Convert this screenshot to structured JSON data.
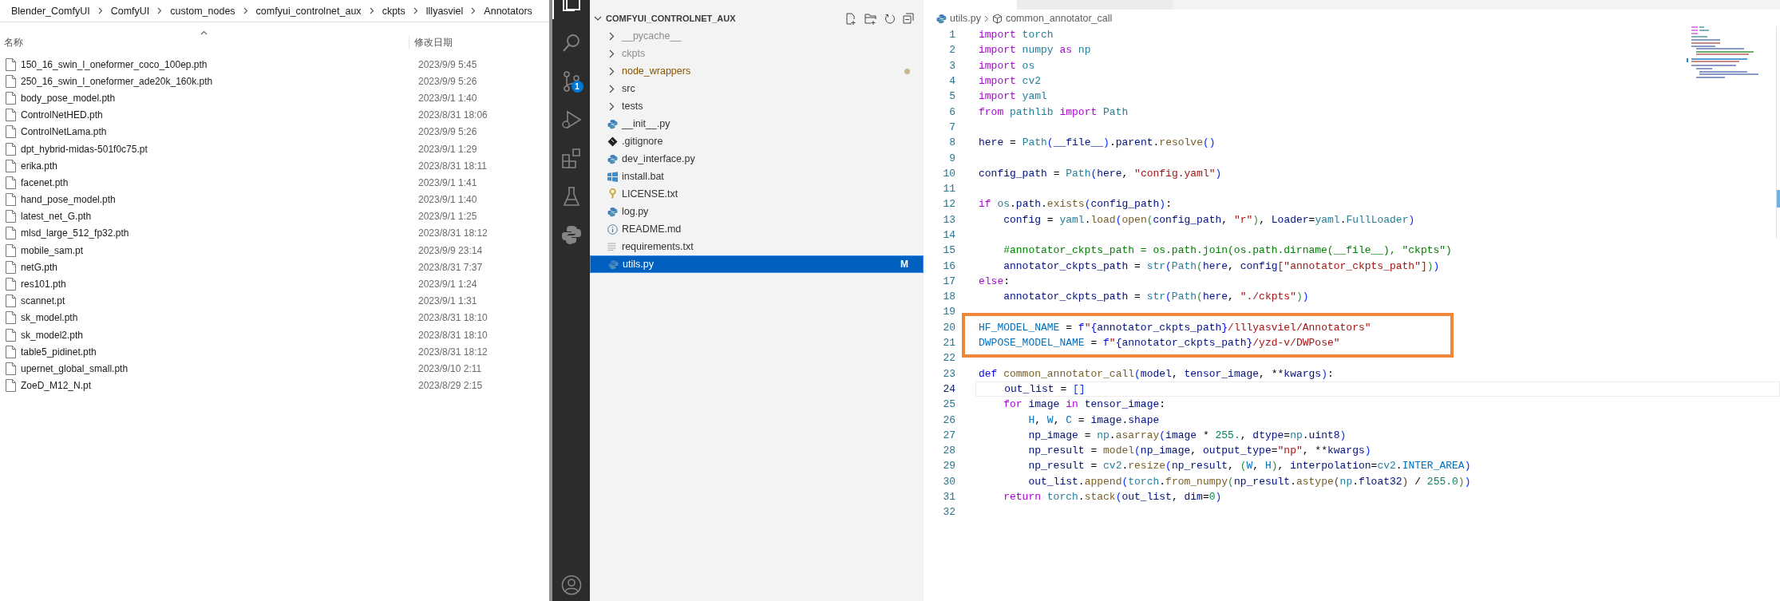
{
  "file_explorer": {
    "breadcrumb": [
      "Blender_ComfyUI",
      "ComfyUI",
      "custom_nodes",
      "comfyui_controlnet_aux",
      "ckpts",
      "lllyasviel",
      "Annotators"
    ],
    "columns": [
      "名称",
      "修改日期"
    ],
    "files": [
      {
        "name": "150_16_swin_l_oneformer_coco_100ep.pth",
        "date": "2023/9/9 5:45"
      },
      {
        "name": "250_16_swin_l_oneformer_ade20k_160k.pth",
        "date": "2023/9/9 5:26"
      },
      {
        "name": "body_pose_model.pth",
        "date": "2023/9/1 1:40"
      },
      {
        "name": "ControlNetHED.pth",
        "date": "2023/8/31 18:06"
      },
      {
        "name": "ControlNetLama.pth",
        "date": "2023/9/9 5:26"
      },
      {
        "name": "dpt_hybrid-midas-501f0c75.pt",
        "date": "2023/9/1 1:29"
      },
      {
        "name": "erika.pth",
        "date": "2023/8/31 18:11"
      },
      {
        "name": "facenet.pth",
        "date": "2023/9/1 1:41"
      },
      {
        "name": "hand_pose_model.pth",
        "date": "2023/9/1 1:40"
      },
      {
        "name": "latest_net_G.pth",
        "date": "2023/9/1 1:25"
      },
      {
        "name": "mlsd_large_512_fp32.pth",
        "date": "2023/8/31 18:12"
      },
      {
        "name": "mobile_sam.pt",
        "date": "2023/9/9 23:14"
      },
      {
        "name": "netG.pth",
        "date": "2023/8/31 7:37"
      },
      {
        "name": "res101.pth",
        "date": "2023/9/1 1:24"
      },
      {
        "name": "scannet.pt",
        "date": "2023/9/1 1:31"
      },
      {
        "name": "sk_model.pth",
        "date": "2023/8/31 18:10"
      },
      {
        "name": "sk_model2.pth",
        "date": "2023/8/31 18:10"
      },
      {
        "name": "table5_pidinet.pth",
        "date": "2023/8/31 18:12"
      },
      {
        "name": "upernet_global_small.pth",
        "date": "2023/9/10 2:11"
      },
      {
        "name": "ZoeD_M12_N.pt",
        "date": "2023/8/29 2:15"
      }
    ]
  },
  "activity_bar": {
    "source_control_badge": "1"
  },
  "sidebar": {
    "title": "COMFYUI_CONTROLNET_AUX",
    "items": [
      {
        "kind": "folder",
        "label": "__pycache__",
        "ignored": true,
        "has_changes": false,
        "selected": false
      },
      {
        "kind": "folder",
        "label": "ckpts",
        "ignored": true,
        "has_changes": false,
        "selected": false
      },
      {
        "kind": "folder",
        "label": "node_wrappers",
        "ignored": false,
        "has_changes": true,
        "selected": false
      },
      {
        "kind": "folder",
        "label": "src",
        "ignored": false,
        "has_changes": false,
        "selected": false
      },
      {
        "kind": "folder",
        "label": "tests",
        "ignored": false,
        "has_changes": false,
        "selected": false
      },
      {
        "kind": "python",
        "label": "__init__.py",
        "ignored": false,
        "has_changes": false,
        "selected": false
      },
      {
        "kind": "git",
        "label": ".gitignore",
        "ignored": false,
        "has_changes": false,
        "selected": false
      },
      {
        "kind": "python",
        "label": "dev_interface.py",
        "ignored": false,
        "has_changes": false,
        "selected": false
      },
      {
        "kind": "windows",
        "label": "install.bat",
        "ignored": false,
        "has_changes": false,
        "selected": false
      },
      {
        "kind": "license",
        "label": "LICENSE.txt",
        "ignored": false,
        "has_changes": false,
        "selected": false
      },
      {
        "kind": "python",
        "label": "log.py",
        "ignored": false,
        "has_changes": false,
        "selected": false
      },
      {
        "kind": "info",
        "label": "README.md",
        "ignored": false,
        "has_changes": false,
        "selected": false
      },
      {
        "kind": "text",
        "label": "requirements.txt",
        "ignored": false,
        "has_changes": false,
        "selected": false
      },
      {
        "kind": "python",
        "label": "utils.py",
        "ignored": false,
        "has_changes": false,
        "selected": true,
        "status": "M"
      }
    ]
  },
  "editor": {
    "breadcrumb": {
      "file": "utils.py",
      "symbol": "common_annotator_call"
    },
    "lines": [
      {
        "number": "1",
        "current": false,
        "boxed": false,
        "tokens": [
          {
            "kind": "keyword",
            "text": "import"
          },
          {
            "kind": "module",
            "text": " torch"
          }
        ]
      },
      {
        "number": "2",
        "current": false,
        "boxed": false,
        "tokens": [
          {
            "kind": "keyword",
            "text": "import"
          },
          {
            "kind": "module",
            "text": " numpy "
          },
          {
            "kind": "keyword",
            "text": "as"
          },
          {
            "kind": "module",
            "text": " np"
          }
        ]
      },
      {
        "number": "3",
        "current": false,
        "boxed": false,
        "tokens": [
          {
            "kind": "keyword",
            "text": "import"
          },
          {
            "kind": "module",
            "text": " os"
          }
        ]
      },
      {
        "number": "4",
        "current": false,
        "boxed": false,
        "tokens": [
          {
            "kind": "keyword",
            "text": "import"
          },
          {
            "kind": "module",
            "text": " cv2"
          }
        ]
      },
      {
        "number": "5",
        "current": false,
        "boxed": false,
        "tokens": [
          {
            "kind": "keyword",
            "text": "import"
          },
          {
            "kind": "module",
            "text": " yaml"
          }
        ]
      },
      {
        "number": "6",
        "current": false,
        "boxed": false,
        "tokens": [
          {
            "kind": "keyword",
            "text": "from"
          },
          {
            "kind": "module",
            "text": " pathlib "
          },
          {
            "kind": "keyword",
            "text": "import"
          },
          {
            "kind": "module",
            "text": " Path"
          }
        ]
      },
      {
        "number": "7",
        "current": false,
        "boxed": false
      },
      {
        "number": "8",
        "current": false,
        "boxed": false,
        "tokens": [
          {
            "kind": "variable",
            "text": "here"
          },
          {
            "kind": "plain",
            "text": " = "
          },
          {
            "kind": "module",
            "text": "Path"
          },
          {
            "kind": "bracket1",
            "text": "("
          },
          {
            "kind": "variable",
            "text": "__file__"
          },
          {
            "kind": "bracket1",
            "text": ")"
          },
          {
            "kind": "plain",
            "text": "."
          },
          {
            "kind": "variable",
            "text": "parent"
          },
          {
            "kind": "plain",
            "text": "."
          },
          {
            "kind": "function",
            "text": "resolve"
          },
          {
            "kind": "bracket1",
            "text": "()"
          }
        ]
      },
      {
        "number": "9",
        "current": false,
        "boxed": false
      },
      {
        "number": "10",
        "current": false,
        "boxed": false,
        "tokens": [
          {
            "kind": "variable",
            "text": "config_path"
          },
          {
            "kind": "plain",
            "text": " = "
          },
          {
            "kind": "module",
            "text": "Path"
          },
          {
            "kind": "bracket1",
            "text": "("
          },
          {
            "kind": "variable",
            "text": "here"
          },
          {
            "kind": "plain",
            "text": ", "
          },
          {
            "kind": "string",
            "text": "\"config.yaml\""
          },
          {
            "kind": "bracket1",
            "text": ")"
          }
        ]
      },
      {
        "number": "11",
        "current": false,
        "boxed": false
      },
      {
        "number": "12",
        "current": false,
        "boxed": false,
        "tokens": [
          {
            "kind": "keyword",
            "text": "if"
          },
          {
            "kind": "module",
            "text": " os"
          },
          {
            "kind": "plain",
            "text": "."
          },
          {
            "kind": "variable",
            "text": "path"
          },
          {
            "kind": "plain",
            "text": "."
          },
          {
            "kind": "function",
            "text": "exists"
          },
          {
            "kind": "bracket1",
            "text": "("
          },
          {
            "kind": "variable",
            "text": "config_path"
          },
          {
            "kind": "bracket1",
            "text": ")"
          },
          {
            "kind": "plain",
            "text": ":"
          }
        ]
      },
      {
        "number": "13",
        "current": false,
        "boxed": false,
        "tokens": [
          {
            "kind": "variable",
            "text": "    config"
          },
          {
            "kind": "plain",
            "text": " = "
          },
          {
            "kind": "module",
            "text": "yaml"
          },
          {
            "kind": "plain",
            "text": "."
          },
          {
            "kind": "function",
            "text": "load"
          },
          {
            "kind": "bracket1",
            "text": "("
          },
          {
            "kind": "function",
            "text": "open"
          },
          {
            "kind": "bracket2",
            "text": "("
          },
          {
            "kind": "variable",
            "text": "config_path"
          },
          {
            "kind": "plain",
            "text": ", "
          },
          {
            "kind": "string",
            "text": "\"r\""
          },
          {
            "kind": "bracket2",
            "text": ")"
          },
          {
            "kind": "plain",
            "text": ", "
          },
          {
            "kind": "variable",
            "text": "Loader"
          },
          {
            "kind": "plain",
            "text": "="
          },
          {
            "kind": "module",
            "text": "yaml"
          },
          {
            "kind": "plain",
            "text": "."
          },
          {
            "kind": "module",
            "text": "FullLoader"
          },
          {
            "kind": "bracket1",
            "text": ")"
          }
        ]
      },
      {
        "number": "14",
        "current": false,
        "boxed": false
      },
      {
        "number": "15",
        "current": false,
        "boxed": false,
        "tokens": [
          {
            "kind": "comment",
            "text": "    #annotator_ckpts_path = os.path.join(os.path.dirname(__file__), \"ckpts\")"
          }
        ]
      },
      {
        "number": "16",
        "current": false,
        "boxed": false,
        "tokens": [
          {
            "kind": "variable",
            "text": "    annotator_ckpts_path"
          },
          {
            "kind": "plain",
            "text": " = "
          },
          {
            "kind": "module",
            "text": "str"
          },
          {
            "kind": "bracket1",
            "text": "("
          },
          {
            "kind": "module",
            "text": "Path"
          },
          {
            "kind": "bracket2",
            "text": "("
          },
          {
            "kind": "variable",
            "text": "here"
          },
          {
            "kind": "plain",
            "text": ", "
          },
          {
            "kind": "variable",
            "text": "config"
          },
          {
            "kind": "bracket3",
            "text": "["
          },
          {
            "kind": "string",
            "text": "\"annotator_ckpts_path\""
          },
          {
            "kind": "bracket3",
            "text": "]"
          },
          {
            "kind": "bracket2",
            "text": ")"
          },
          {
            "kind": "bracket1",
            "text": ")"
          }
        ]
      },
      {
        "number": "17",
        "current": false,
        "boxed": false,
        "tokens": [
          {
            "kind": "keyword",
            "text": "else"
          },
          {
            "kind": "plain",
            "text": ":"
          }
        ]
      },
      {
        "number": "18",
        "current": false,
        "boxed": false,
        "tokens": [
          {
            "kind": "variable",
            "text": "    annotator_ckpts_path"
          },
          {
            "kind": "plain",
            "text": " = "
          },
          {
            "kind": "module",
            "text": "str"
          },
          {
            "kind": "bracket1",
            "text": "("
          },
          {
            "kind": "module",
            "text": "Path"
          },
          {
            "kind": "bracket2",
            "text": "("
          },
          {
            "kind": "variable",
            "text": "here"
          },
          {
            "kind": "plain",
            "text": ", "
          },
          {
            "kind": "string",
            "text": "\"./ckpts\""
          },
          {
            "kind": "bracket2",
            "text": ")"
          },
          {
            "kind": "bracket1",
            "text": ")"
          }
        ]
      },
      {
        "number": "19",
        "current": false,
        "boxed": false
      },
      {
        "number": "20",
        "current": false,
        "boxed": true,
        "tokens": [
          {
            "kind": "constant",
            "text": "HF_MODEL_NAME"
          },
          {
            "kind": "plain",
            "text": " = "
          },
          {
            "kind": "storage",
            "text": "f"
          },
          {
            "kind": "string",
            "text": "\""
          },
          {
            "kind": "storage",
            "text": "{"
          },
          {
            "kind": "variable",
            "text": "annotator_ckpts_path"
          },
          {
            "kind": "storage",
            "text": "}"
          },
          {
            "kind": "string",
            "text": "/lllyasviel/Annotators\""
          }
        ]
      },
      {
        "number": "21",
        "current": false,
        "boxed": true,
        "tokens": [
          {
            "kind": "constant",
            "text": "DWPOSE_MODEL_NAME"
          },
          {
            "kind": "plain",
            "text": " = "
          },
          {
            "kind": "storage",
            "text": "f"
          },
          {
            "kind": "string",
            "text": "\""
          },
          {
            "kind": "storage",
            "text": "{"
          },
          {
            "kind": "variable",
            "text": "annotator_ckpts_path"
          },
          {
            "kind": "storage",
            "text": "}"
          },
          {
            "kind": "string",
            "text": "/yzd-v/DWPose\""
          }
        ]
      },
      {
        "number": "22",
        "current": false,
        "boxed": false
      },
      {
        "number": "23",
        "current": false,
        "boxed": false,
        "tokens": [
          {
            "kind": "storage",
            "text": "def"
          },
          {
            "kind": "function",
            "text": " common_annotator_call"
          },
          {
            "kind": "bracket1",
            "text": "("
          },
          {
            "kind": "variable",
            "text": "model"
          },
          {
            "kind": "plain",
            "text": ", "
          },
          {
            "kind": "variable",
            "text": "tensor_image"
          },
          {
            "kind": "plain",
            "text": ", **"
          },
          {
            "kind": "variable",
            "text": "kwargs"
          },
          {
            "kind": "bracket1",
            "text": ")"
          },
          {
            "kind": "plain",
            "text": ":"
          }
        ]
      },
      {
        "number": "24",
        "current": true,
        "boxed": false,
        "tokens": [
          {
            "kind": "variable",
            "text": "    out_list"
          },
          {
            "kind": "plain",
            "text": " = "
          },
          {
            "kind": "bracket1",
            "text": "[]"
          }
        ]
      },
      {
        "number": "25",
        "current": false,
        "boxed": false,
        "tokens": [
          {
            "kind": "keyword",
            "text": "    for"
          },
          {
            "kind": "variable",
            "text": " image "
          },
          {
            "kind": "keyword",
            "text": "in"
          },
          {
            "kind": "variable",
            "text": " tensor_image"
          },
          {
            "kind": "plain",
            "text": ":"
          }
        ]
      },
      {
        "number": "26",
        "current": false,
        "boxed": false,
        "tokens": [
          {
            "kind": "constant",
            "text": "        H"
          },
          {
            "kind": "plain",
            "text": ", "
          },
          {
            "kind": "constant",
            "text": "W"
          },
          {
            "kind": "plain",
            "text": ", "
          },
          {
            "kind": "constant",
            "text": "C"
          },
          {
            "kind": "plain",
            "text": " = "
          },
          {
            "kind": "variable",
            "text": "image"
          },
          {
            "kind": "plain",
            "text": "."
          },
          {
            "kind": "variable",
            "text": "shape"
          }
        ]
      },
      {
        "number": "27",
        "current": false,
        "boxed": false,
        "tokens": [
          {
            "kind": "variable",
            "text": "        np_image"
          },
          {
            "kind": "plain",
            "text": " = "
          },
          {
            "kind": "module",
            "text": "np"
          },
          {
            "kind": "plain",
            "text": "."
          },
          {
            "kind": "function",
            "text": "asarray"
          },
          {
            "kind": "bracket1",
            "text": "("
          },
          {
            "kind": "variable",
            "text": "image"
          },
          {
            "kind": "plain",
            "text": " * "
          },
          {
            "kind": "number",
            "text": "255."
          },
          {
            "kind": "plain",
            "text": ", "
          },
          {
            "kind": "variable",
            "text": "dtype"
          },
          {
            "kind": "plain",
            "text": "="
          },
          {
            "kind": "module",
            "text": "np"
          },
          {
            "kind": "plain",
            "text": "."
          },
          {
            "kind": "variable",
            "text": "uint8"
          },
          {
            "kind": "bracket1",
            "text": ")"
          }
        ]
      },
      {
        "number": "28",
        "current": false,
        "boxed": false,
        "tokens": [
          {
            "kind": "variable",
            "text": "        np_result"
          },
          {
            "kind": "plain",
            "text": " = "
          },
          {
            "kind": "function",
            "text": "model"
          },
          {
            "kind": "bracket1",
            "text": "("
          },
          {
            "kind": "variable",
            "text": "np_image"
          },
          {
            "kind": "plain",
            "text": ", "
          },
          {
            "kind": "variable",
            "text": "output_type"
          },
          {
            "kind": "plain",
            "text": "="
          },
          {
            "kind": "string",
            "text": "\"np\""
          },
          {
            "kind": "plain",
            "text": ", **"
          },
          {
            "kind": "variable",
            "text": "kwargs"
          },
          {
            "kind": "bracket1",
            "text": ")"
          }
        ]
      },
      {
        "number": "29",
        "current": false,
        "boxed": false,
        "tokens": [
          {
            "kind": "variable",
            "text": "        np_result"
          },
          {
            "kind": "plain",
            "text": " = "
          },
          {
            "kind": "module",
            "text": "cv2"
          },
          {
            "kind": "plain",
            "text": "."
          },
          {
            "kind": "function",
            "text": "resize"
          },
          {
            "kind": "bracket1",
            "text": "("
          },
          {
            "kind": "variable",
            "text": "np_result"
          },
          {
            "kind": "plain",
            "text": ", "
          },
          {
            "kind": "bracket2",
            "text": "("
          },
          {
            "kind": "constant",
            "text": "W"
          },
          {
            "kind": "plain",
            "text": ", "
          },
          {
            "kind": "constant",
            "text": "H"
          },
          {
            "kind": "bracket2",
            "text": ")"
          },
          {
            "kind": "plain",
            "text": ", "
          },
          {
            "kind": "variable",
            "text": "interpolation"
          },
          {
            "kind": "plain",
            "text": "="
          },
          {
            "kind": "module",
            "text": "cv2"
          },
          {
            "kind": "plain",
            "text": "."
          },
          {
            "kind": "constant",
            "text": "INTER_AREA"
          },
          {
            "kind": "bracket1",
            "text": ")"
          }
        ]
      },
      {
        "number": "30",
        "current": false,
        "boxed": false,
        "tokens": [
          {
            "kind": "variable",
            "text": "        out_list"
          },
          {
            "kind": "plain",
            "text": "."
          },
          {
            "kind": "function",
            "text": "append"
          },
          {
            "kind": "bracket1",
            "text": "("
          },
          {
            "kind": "module",
            "text": "torch"
          },
          {
            "kind": "plain",
            "text": "."
          },
          {
            "kind": "function",
            "text": "from_numpy"
          },
          {
            "kind": "bracket2",
            "text": "("
          },
          {
            "kind": "variable",
            "text": "np_result"
          },
          {
            "kind": "plain",
            "text": "."
          },
          {
            "kind": "function",
            "text": "astype"
          },
          {
            "kind": "bracket3",
            "text": "("
          },
          {
            "kind": "module",
            "text": "np"
          },
          {
            "kind": "plain",
            "text": "."
          },
          {
            "kind": "variable",
            "text": "float32"
          },
          {
            "kind": "bracket3",
            "text": ")"
          },
          {
            "kind": "plain",
            "text": " / "
          },
          {
            "kind": "number",
            "text": "255.0"
          },
          {
            "kind": "bracket2",
            "text": ")"
          },
          {
            "kind": "bracket1",
            "text": ")"
          }
        ]
      },
      {
        "number": "31",
        "current": false,
        "boxed": false,
        "tokens": [
          {
            "kind": "keyword",
            "text": "    return"
          },
          {
            "kind": "module",
            "text": " torch"
          },
          {
            "kind": "plain",
            "text": "."
          },
          {
            "kind": "function",
            "text": "stack"
          },
          {
            "kind": "bracket1",
            "text": "("
          },
          {
            "kind": "variable",
            "text": "out_list"
          },
          {
            "kind": "plain",
            "text": ", "
          },
          {
            "kind": "variable",
            "text": "dim"
          },
          {
            "kind": "plain",
            "text": "="
          },
          {
            "kind": "number",
            "text": "0"
          },
          {
            "kind": "bracket1",
            "text": ")"
          }
        ]
      },
      {
        "number": "32",
        "current": false,
        "boxed": false
      }
    ]
  }
}
